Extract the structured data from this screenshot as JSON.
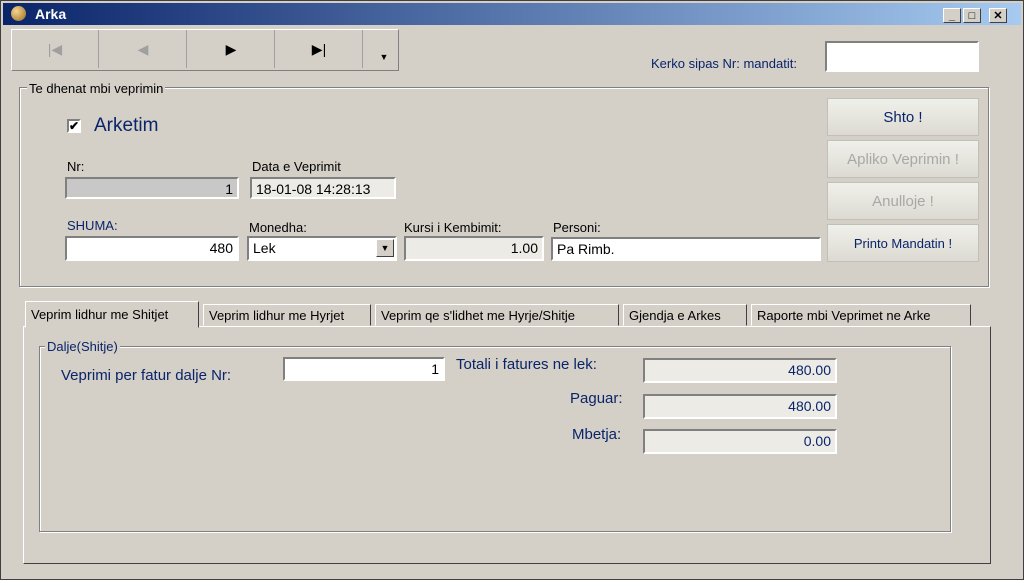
{
  "window": {
    "title": "Arka"
  },
  "toolbar": {
    "first": "|◀",
    "prev": "◀",
    "next": "▶",
    "last": "▶|",
    "more": "▼"
  },
  "search": {
    "label": "Kerko sipas Nr: mandatit:",
    "value": ""
  },
  "details": {
    "group_title": "Te dhenat mbi veprimin",
    "arketim_label": "Arketim",
    "arketim_checked": "✔",
    "nr_label": "Nr:",
    "nr_value": "1",
    "date_label": "Data e Veprimit",
    "date_value": "18-01-08 14:28:13",
    "shuma_label": "SHUMA:",
    "shuma_value": "480",
    "monedha_label": "Monedha:",
    "monedha_value": "Lek",
    "kursi_label": "Kursi i Kembimit:",
    "kursi_value": "1.00",
    "personi_label": "Personi:",
    "personi_value": "Pa Rimb."
  },
  "actions": {
    "shto": "Shto !",
    "apliko": "Apliko Veprimin !",
    "anulloje": "Anulloje !",
    "printo": "Printo Mandatin !"
  },
  "tabs": [
    {
      "label": "Veprim lidhur me Shitjet"
    },
    {
      "label": "Veprim lidhur me Hyrjet"
    },
    {
      "label": "Veprim qe s'lidhet me Hyrje/Shitje"
    },
    {
      "label": "Gjendja e Arkes"
    },
    {
      "label": "Raporte mbi Veprimet ne Arke"
    }
  ],
  "dalje": {
    "group_title": "Dalje(Shitje)",
    "fatura_label": "Veprimi per fatur dalje Nr:",
    "fatura_value": "1",
    "totali_label": "Totali i fatures ne lek:",
    "totali_value": "480.00",
    "paguar_label": "Paguar:",
    "paguar_value": "480.00",
    "mbetja_label": "Mbetja:",
    "mbetja_value": "0.00"
  },
  "colors": {
    "title_start": "#0a246a",
    "title_end": "#a6caf0",
    "face": "#d4d0c8",
    "label_navy": "#0a246a"
  }
}
